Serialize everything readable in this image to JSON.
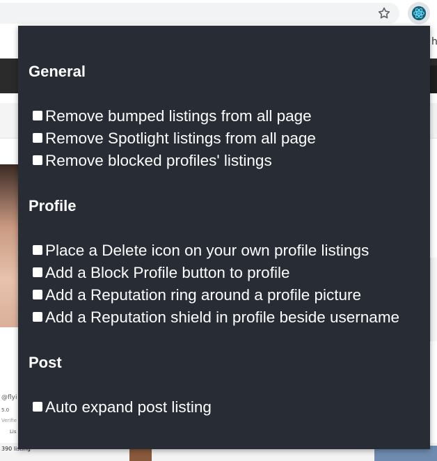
{
  "browser": {
    "star_icon": "star-outline-icon",
    "extension_icon": "react-atom-icon",
    "extension_color": "#1b5f74",
    "background_text": {
      "top_right": "h",
      "username": "@flyi",
      "rating": "5.0",
      "verified": "Verifie",
      "listings": "Lis",
      "count": "390 listing"
    }
  },
  "popup": {
    "background": "#282c35",
    "sections": [
      {
        "title": "General",
        "options": [
          {
            "label": "Remove bumped listings from all page",
            "checked": false
          },
          {
            "label": "Remove Spotlight listings from all page",
            "checked": false
          },
          {
            "label": "Remove blocked profiles' listings",
            "checked": false
          }
        ]
      },
      {
        "title": "Profile",
        "options": [
          {
            "label": "Place a Delete icon on your own profile listings",
            "checked": false
          },
          {
            "label": "Add a Block Profile button to profile",
            "checked": false
          },
          {
            "label": "Add a Reputation ring around a profile picture",
            "checked": false
          },
          {
            "label": "Add a Reputation shield in profile beside username",
            "checked": false
          }
        ]
      },
      {
        "title": "Post",
        "options": [
          {
            "label": "Auto expand post listing",
            "checked": false
          }
        ]
      }
    ]
  }
}
